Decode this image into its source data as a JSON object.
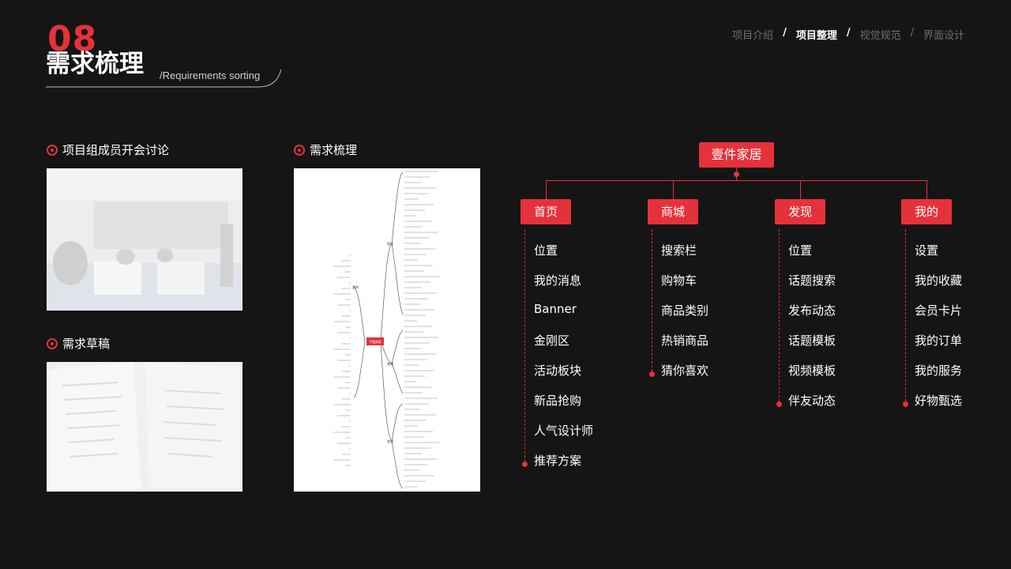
{
  "header": {
    "section_number": "08",
    "title": "需求梳理",
    "subtitle": "/Requirements sorting"
  },
  "nav": {
    "items": [
      {
        "label": "项目介绍",
        "active": false
      },
      {
        "label": "项目整理",
        "active": true
      },
      {
        "label": "视觉规范",
        "active": false
      },
      {
        "label": "界面设计",
        "active": false
      }
    ],
    "separator": "/"
  },
  "sections": {
    "meeting_label": "项目组成员开会讨论",
    "draft_label": "需求草稿",
    "mindmap_label": "需求梳理"
  },
  "mindmap": {
    "root": "YIBAN",
    "branches": [
      "首页",
      "商城",
      "发现",
      "我的"
    ]
  },
  "tree": {
    "root": "壹件家居",
    "columns": [
      {
        "title": "首页",
        "items": [
          "位置",
          "我的消息",
          "Banner",
          "金刚区",
          "活动板块",
          "新品抢购",
          "人气设计师",
          "推荐方案"
        ]
      },
      {
        "title": "商城",
        "items": [
          "搜索栏",
          "购物车",
          "商品类别",
          "热销商品",
          "猜你喜欢"
        ]
      },
      {
        "title": "发现",
        "items": [
          "位置",
          "话题搜索",
          "发布动态",
          "话题模板",
          "视频模板",
          "伴友动态"
        ]
      },
      {
        "title": "我的",
        "items": [
          "设置",
          "我的收藏",
          "会员卡片",
          "我的订单",
          "我的服务",
          "好物甄选"
        ]
      }
    ]
  },
  "colors": {
    "accent": "#e5323a",
    "background": "#151515",
    "nav_inactive": "#707070"
  }
}
